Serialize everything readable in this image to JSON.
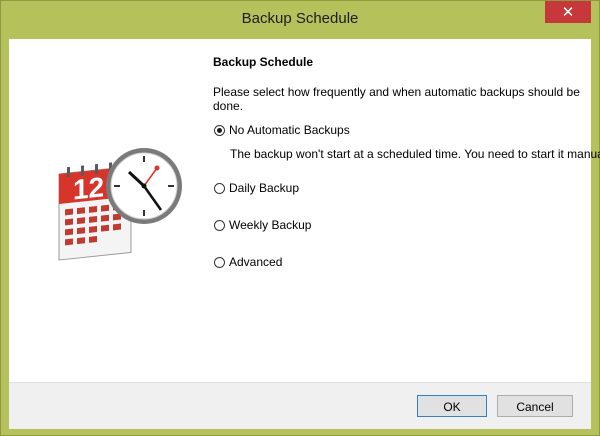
{
  "window": {
    "title": "Backup Schedule",
    "close_glyph": "✕"
  },
  "content": {
    "heading": "Backup Schedule",
    "description": "Please select how frequently and when automatic backups should be done.",
    "options": [
      {
        "label": "No Automatic Backups",
        "checked": true
      },
      {
        "label": "Daily Backup",
        "checked": false
      },
      {
        "label": "Weekly Backup",
        "checked": false
      },
      {
        "label": "Advanced",
        "checked": false
      }
    ],
    "selected_note": "The backup won't start at a scheduled time. You need to start it manually"
  },
  "illustration": {
    "icon": "calendar-clock-icon",
    "calendar_number": "12"
  },
  "footer": {
    "ok_label": "OK",
    "cancel_label": "Cancel"
  },
  "colors": {
    "title_bar": "#b5c25c",
    "close_button": "#c7383a",
    "calendar_red": "#d7342b"
  }
}
